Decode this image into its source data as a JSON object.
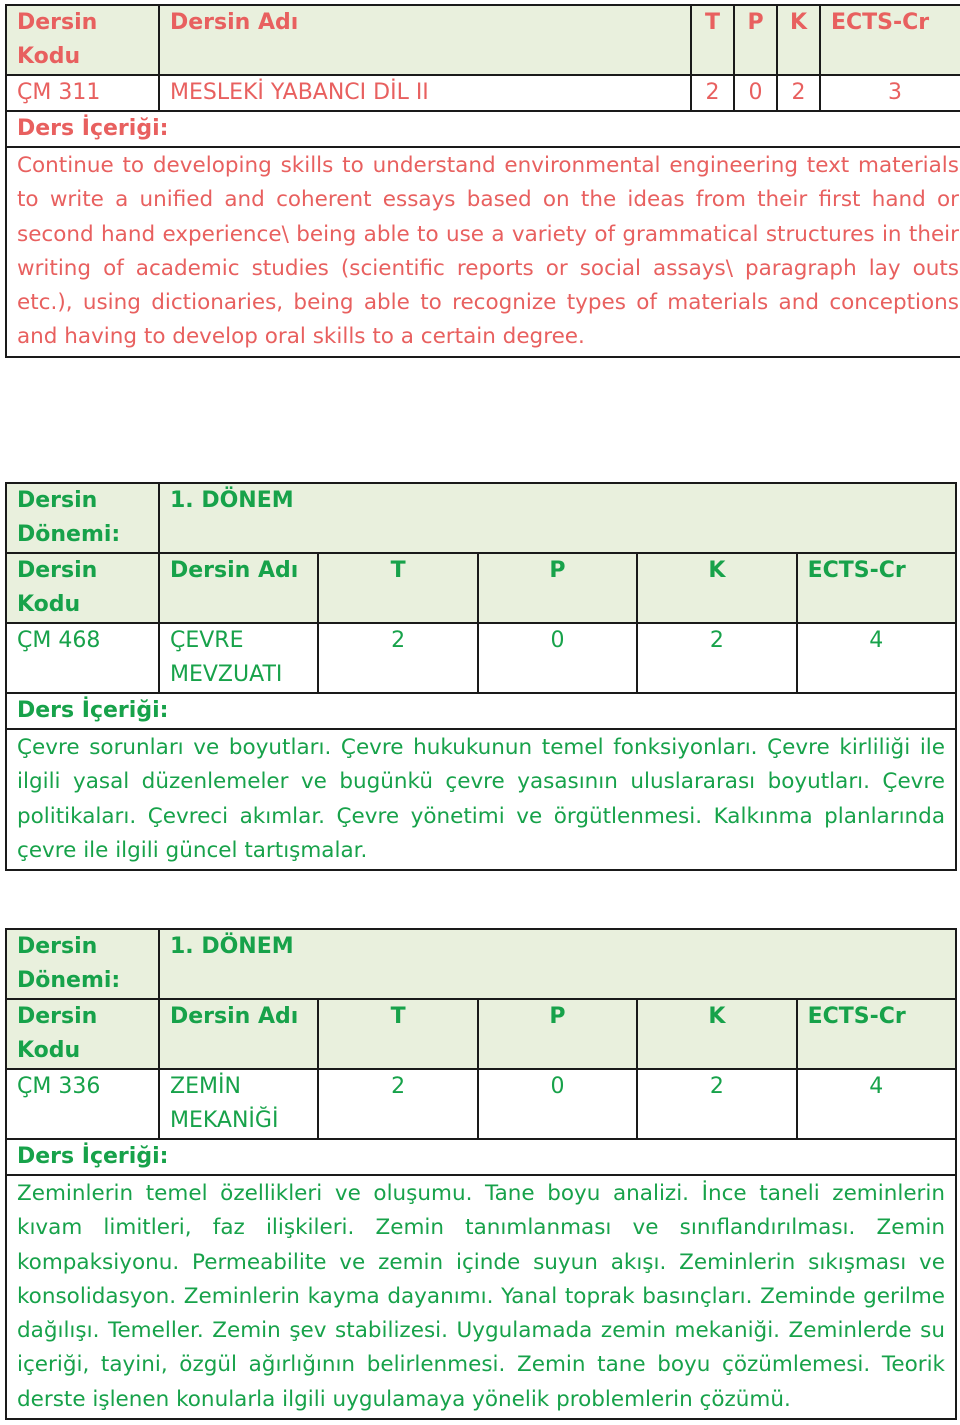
{
  "colors": {
    "red_text": "#e8605f",
    "green_text": "#17a24a",
    "header_bg": "#e9f0dd",
    "border": "#1a1a1a"
  },
  "labels": {
    "period": "Dersin Dönemi:",
    "code": "Dersin Kodu",
    "name": "Dersin Adı",
    "t": "T",
    "p": "P",
    "k": "K",
    "ects": "ECTS-Cr",
    "content": "Ders İçeriği:"
  },
  "courses": [
    {
      "code": "ÇM 311",
      "name": "MESLEKİ YABANCI DİL II",
      "t": "2",
      "p": "0",
      "k": "2",
      "ects": "3",
      "content": "Continue to developing skills to understand environmental engineering text materials to write a unified and coherent essays based on the ideas from their first hand or second hand experience\\ being able to use a variety of grammatical structures in their writing of academic studies (scientific reports or social assays\\ paragraph lay outs etc.), using dictionaries, being able to recognize types of materials and conceptions and having to develop oral skills to a certain degree."
    },
    {
      "period": "1. DÖNEM",
      "code": "ÇM 468",
      "name": "ÇEVRE MEVZUATI",
      "t": "2",
      "p": "0",
      "k": "2",
      "ects": "4",
      "content": "Çevre sorunları ve boyutları. Çevre hukukunun temel fonksiyonları. Çevre kirliliği ile ilgili yasal düzenlemeler ve bugünkü çevre yasasının uluslararası boyutları. Çevre politikaları. Çevreci akımlar. Çevre yönetimi ve örgütlenmesi. Kalkınma planlarında çevre ile ilgili güncel tartışmalar."
    },
    {
      "period": "1. DÖNEM",
      "code": "ÇM 336",
      "name": "ZEMİN MEKANİĞİ",
      "t": "2",
      "p": "0",
      "k": "2",
      "ects": "4",
      "content": "Zeminlerin temel özellikleri ve oluşumu. Tane boyu analizi. İnce taneli zeminlerin kıvam limitleri, faz ilişkileri. Zemin tanımlanması ve sınıflandırılması. Zemin kompaksiyonu. Permeabilite ve zemin içinde suyun akışı. Zeminlerin sıkışması ve konsolidasyon. Zeminlerin kayma dayanımı. Yanal toprak basınçları. Zeminde gerilme dağılışı. Temeller. Zemin şev stabilizesi. Uygulamada zemin mekaniği. Zeminlerde su içeriği, tayini, özgül ağırlığının belirlenmesi. Zemin tane boyu çözümlemesi. Teorik derste işlenen konularla ilgili uygulamaya yönelik problemlerin çözümü."
    }
  ]
}
